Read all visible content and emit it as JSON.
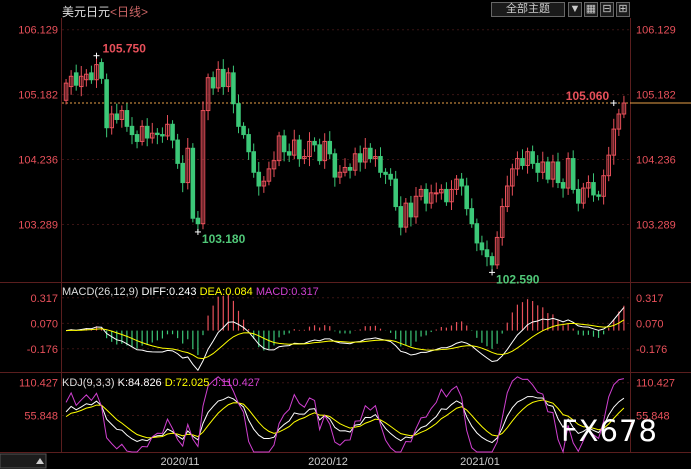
{
  "header": {
    "symbol": "美元日元",
    "period": "<日线>",
    "dropdown_label": "全部主题",
    "buttons": [
      "▼",
      "▦",
      "⊟",
      "⊞"
    ]
  },
  "watermark": "FX678",
  "colors": {
    "up": "#e8505a",
    "down": "#3cc878",
    "axis_text": "#e8505a",
    "grid": "#3a1414",
    "dif": "#ffffff",
    "dea": "#ffff00",
    "macd": "#d040d0",
    "k": "#ffffff",
    "d": "#ffff00",
    "j": "#d040d0",
    "current_line": "#e8a048"
  },
  "chart_data": [
    {
      "type": "candlestick",
      "yticks": [
        "106.129",
        "105.182",
        "104.236",
        "103.289"
      ],
      "ylim": [
        102.45,
        106.3
      ],
      "xticks": [
        "2020/11",
        "2020/12",
        "2021/01"
      ],
      "annotations": [
        {
          "text": "105.750",
          "value": 105.75,
          "index": 6,
          "color": "up"
        },
        {
          "text": "103.180",
          "value": 103.18,
          "index": 26,
          "color": "down"
        },
        {
          "text": "102.590",
          "value": 102.59,
          "index": 84,
          "color": "down"
        },
        {
          "text": "105.060",
          "value": 105.06,
          "index": 108,
          "color": "up"
        }
      ],
      "current_price": 105.06,
      "candles_close": [
        105.35,
        105.45,
        105.32,
        105.45,
        105.48,
        105.4,
        105.62,
        105.42,
        104.7,
        104.9,
        104.82,
        104.95,
        104.72,
        104.6,
        104.5,
        104.72,
        104.55,
        104.62,
        104.6,
        104.58,
        104.75,
        104.52,
        104.18,
        103.9,
        104.4,
        103.38,
        103.3,
        104.95,
        105.43,
        105.28,
        105.55,
        105.3,
        105.5,
        105.05,
        104.72,
        104.6,
        104.35,
        104.05,
        103.85,
        103.92,
        104.1,
        104.22,
        104.58,
        104.35,
        104.3,
        104.52,
        104.25,
        104.28,
        104.5,
        104.45,
        104.22,
        104.5,
        104.32,
        103.98,
        104.05,
        104.12,
        104.08,
        104.32,
        104.2,
        104.4,
        104.25,
        104.28,
        104.05,
        104.02,
        103.95,
        103.55,
        103.25,
        103.6,
        103.4,
        103.7,
        103.8,
        103.6,
        103.75,
        103.75,
        103.8,
        103.62,
        103.8,
        103.95,
        103.85,
        103.52,
        103.3,
        103.02,
        102.92,
        102.82,
        102.7,
        103.1,
        103.55,
        103.85,
        104.1,
        104.25,
        104.15,
        104.35,
        104.18,
        104.05,
        104.2,
        103.95,
        104.2,
        103.9,
        103.82,
        104.25,
        103.8,
        103.6,
        103.82,
        103.9,
        103.72,
        103.7,
        104.0,
        104.3,
        104.68,
        104.9,
        105.06
      ],
      "candles_open": [
        105.1,
        105.3,
        105.5,
        105.3,
        105.4,
        105.5,
        105.4,
        105.65,
        105.4,
        104.7,
        104.9,
        104.82,
        104.95,
        104.72,
        104.6,
        104.5,
        104.72,
        104.55,
        104.62,
        104.6,
        104.58,
        104.75,
        104.52,
        104.18,
        103.9,
        104.4,
        103.38,
        103.3,
        104.95,
        105.43,
        105.28,
        105.55,
        105.3,
        105.5,
        105.05,
        104.72,
        104.6,
        104.35,
        104.05,
        103.85,
        103.92,
        104.1,
        104.22,
        104.58,
        104.35,
        104.3,
        104.52,
        104.25,
        104.28,
        104.5,
        104.45,
        104.22,
        104.5,
        104.32,
        103.98,
        104.05,
        104.12,
        104.08,
        104.32,
        104.2,
        104.4,
        104.25,
        104.28,
        104.05,
        104.02,
        103.95,
        103.55,
        103.25,
        103.6,
        103.4,
        103.7,
        103.8,
        103.6,
        103.75,
        103.75,
        103.8,
        103.62,
        103.8,
        103.95,
        103.85,
        103.52,
        103.3,
        103.02,
        102.92,
        102.82,
        102.7,
        103.1,
        103.55,
        103.85,
        104.1,
        104.25,
        104.15,
        104.35,
        104.18,
        104.05,
        104.2,
        103.95,
        104.2,
        103.9,
        103.82,
        104.25,
        103.8,
        103.6,
        103.82,
        103.9,
        103.72,
        103.7,
        104.0,
        104.3,
        104.68,
        104.9
      ]
    },
    {
      "type": "macd",
      "label": "MACD(26,12,9)",
      "diff_text": "DIFF:0.243",
      "dea_text": "DEA:0.084",
      "macd_text": "MACD:0.317",
      "yticks": [
        "0.317",
        "0.070",
        "-0.176"
      ],
      "ylim": [
        -0.4,
        0.45
      ]
    },
    {
      "type": "kdj",
      "label": "KDJ(9,3,3)",
      "k_text": "K:84.826",
      "d_text": "D:72.025",
      "j_text": "J:110.427",
      "yticks": [
        "110.427",
        "55.848"
      ],
      "ylim": [
        -5,
        125
      ]
    }
  ]
}
